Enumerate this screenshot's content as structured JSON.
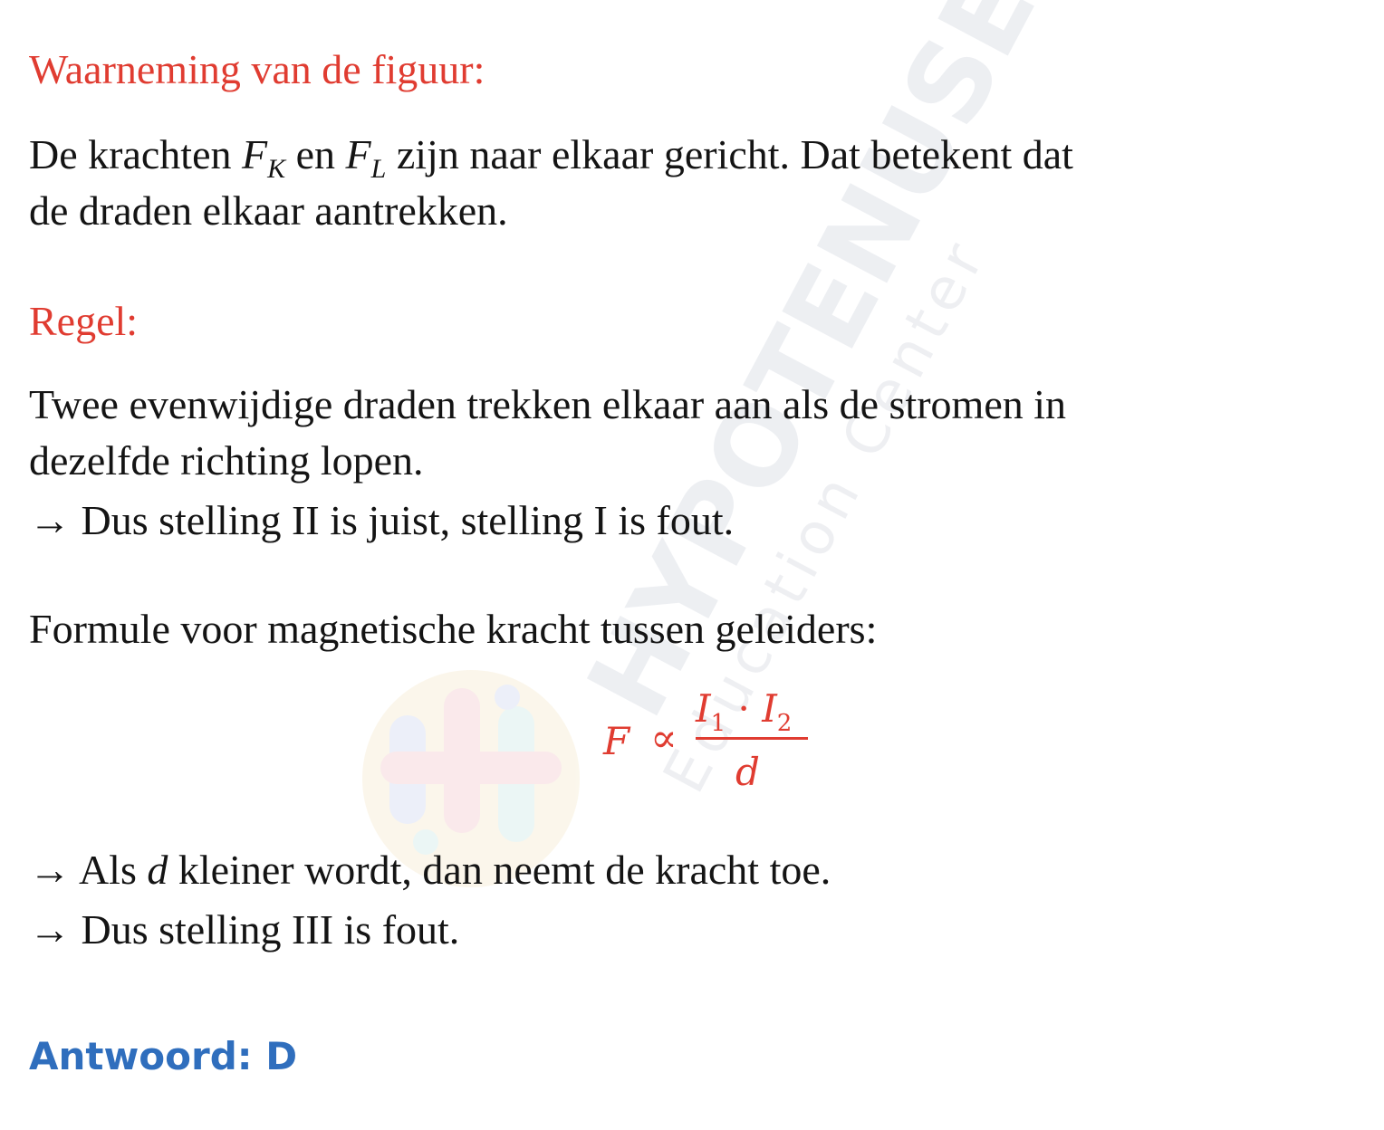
{
  "heading_observation": "Waarneming van de figuur:",
  "observation": {
    "part1": "De krachten ",
    "fk_base": "F",
    "fk_sub": "K",
    "part2": " en ",
    "fl_base": "F",
    "fl_sub": "L",
    "part3": " zijn naar elkaar gericht. Dat betekent dat",
    "line2": "de draden elkaar aantrekken."
  },
  "heading_rule": "Regel:",
  "rule": {
    "line1": "Twee evenwijdige draden trekken elkaar aan als de stromen in",
    "line2": "dezelfde richting lopen.",
    "line3": "→ Dus stelling II is juist, stelling I is fout."
  },
  "formula_intro": "Formule voor magnetische kracht tussen geleiders:",
  "formula": {
    "lhs": "F",
    "relation": "∝",
    "num_i1": "I",
    "num_sub1": "1",
    "num_dot": " · ",
    "num_i2": "I",
    "num_sub2": "2",
    "denominator": "d"
  },
  "conclusion": {
    "l1_prefix": "→ Als ",
    "l1_var": "d",
    "l1_suffix": " kleiner wordt, dan neemt de kracht toe.",
    "l2": "→ Dus stelling III is fout."
  },
  "answer": "Antwoord: D",
  "watermark": {
    "brand": "HYPOTENUSE",
    "tagline": "Education Center"
  },
  "colors": {
    "heading_red": "#e03c31",
    "answer_blue": "#2f6ebd",
    "text": "#141414"
  }
}
